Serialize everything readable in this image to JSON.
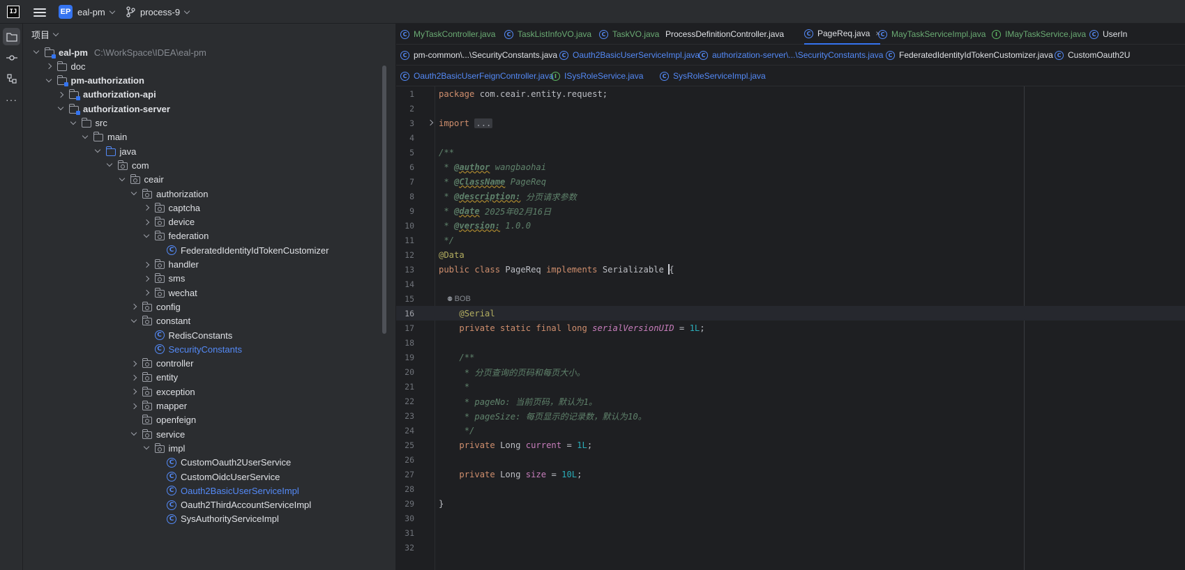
{
  "titlebar": {
    "logo_text": "IJ",
    "project_badge": "EP",
    "project_name": "eal-pm",
    "branch": "process-9"
  },
  "project_panel": {
    "title": "项目",
    "tree": [
      {
        "label": "eal-pm",
        "path": "C:\\WorkSpace\\IDEA\\eal-pm",
        "depth": 0,
        "arrow": "down",
        "icon": "module-folder",
        "bold": true
      },
      {
        "label": "doc",
        "depth": 1,
        "arrow": "right",
        "icon": "folder"
      },
      {
        "label": "pm-authorization",
        "depth": 1,
        "arrow": "down",
        "icon": "module-folder",
        "bold": true
      },
      {
        "label": "authorization-api",
        "depth": 2,
        "arrow": "right",
        "icon": "module-folder",
        "bold": true
      },
      {
        "label": "authorization-server",
        "depth": 2,
        "arrow": "down",
        "icon": "module-folder",
        "bold": true
      },
      {
        "label": "src",
        "depth": 3,
        "arrow": "down",
        "icon": "folder"
      },
      {
        "label": "main",
        "depth": 4,
        "arrow": "down",
        "icon": "folder"
      },
      {
        "label": "java",
        "depth": 5,
        "arrow": "down",
        "icon": "source-folder"
      },
      {
        "label": "com",
        "depth": 6,
        "arrow": "down",
        "icon": "package"
      },
      {
        "label": "ceair",
        "depth": 7,
        "arrow": "down",
        "icon": "package"
      },
      {
        "label": "authorization",
        "depth": 8,
        "arrow": "down",
        "icon": "package"
      },
      {
        "label": "captcha",
        "depth": 9,
        "arrow": "right",
        "icon": "package"
      },
      {
        "label": "device",
        "depth": 9,
        "arrow": "right",
        "icon": "package"
      },
      {
        "label": "federation",
        "depth": 9,
        "arrow": "down",
        "icon": "package"
      },
      {
        "label": "FederatedIdentityIdTokenCustomizer",
        "depth": 10,
        "arrow": "none",
        "icon": "class"
      },
      {
        "label": "handler",
        "depth": 9,
        "arrow": "right",
        "icon": "package"
      },
      {
        "label": "sms",
        "depth": 9,
        "arrow": "right",
        "icon": "package"
      },
      {
        "label": "wechat",
        "depth": 9,
        "arrow": "right",
        "icon": "package"
      },
      {
        "label": "config",
        "depth": 8,
        "arrow": "right",
        "icon": "package"
      },
      {
        "label": "constant",
        "depth": 8,
        "arrow": "down",
        "icon": "package"
      },
      {
        "label": "RedisConstants",
        "depth": 9,
        "arrow": "none",
        "icon": "class"
      },
      {
        "label": "SecurityConstants",
        "depth": 9,
        "arrow": "none",
        "icon": "class",
        "highlight": true
      },
      {
        "label": "controller",
        "depth": 8,
        "arrow": "right",
        "icon": "package"
      },
      {
        "label": "entity",
        "depth": 8,
        "arrow": "right",
        "icon": "package"
      },
      {
        "label": "exception",
        "depth": 8,
        "arrow": "right",
        "icon": "package"
      },
      {
        "label": "mapper",
        "depth": 8,
        "arrow": "right",
        "icon": "package"
      },
      {
        "label": "openfeign",
        "depth": 8,
        "arrow": "none",
        "icon": "package"
      },
      {
        "label": "service",
        "depth": 8,
        "arrow": "down",
        "icon": "package"
      },
      {
        "label": "impl",
        "depth": 9,
        "arrow": "down",
        "icon": "package"
      },
      {
        "label": "CustomOauth2UserService",
        "depth": 10,
        "arrow": "none",
        "icon": "class"
      },
      {
        "label": "CustomOidcUserService",
        "depth": 10,
        "arrow": "none",
        "icon": "class"
      },
      {
        "label": "Oauth2BasicUserServiceImpl",
        "depth": 10,
        "arrow": "none",
        "icon": "class",
        "highlight": true
      },
      {
        "label": "Oauth2ThirdAccountServiceImpl",
        "depth": 10,
        "arrow": "none",
        "icon": "class"
      },
      {
        "label": "SysAuthorityServiceImpl",
        "depth": 10,
        "arrow": "none",
        "icon": "class"
      }
    ]
  },
  "tabs": {
    "row1": [
      {
        "label": "MyTaskController.java",
        "icon": "class",
        "color": "green"
      },
      {
        "label": "TaskListInfoVO.java",
        "icon": "class",
        "color": "green"
      },
      {
        "label": "TaskVO.java",
        "icon": "class",
        "color": "green"
      },
      {
        "label": "ProcessDefinitionController.java",
        "icon": "none",
        "color": "normal"
      },
      {
        "label": "PageReq.java",
        "icon": "class",
        "color": "normal",
        "active": true,
        "close": "×"
      },
      {
        "label": "MayTaskServiceImpl.java",
        "icon": "class",
        "color": "green"
      },
      {
        "label": "IMayTaskService.java",
        "icon": "interface",
        "color": "green"
      },
      {
        "label": "UserIn",
        "icon": "class",
        "color": "normal"
      }
    ],
    "row2": [
      {
        "label": "pm-common\\...\\SecurityConstants.java",
        "icon": "class",
        "color": "normal"
      },
      {
        "label": "Oauth2BasicUserServiceImpl.java",
        "icon": "class",
        "color": "blue"
      },
      {
        "label": "authorization-server\\...\\SecurityConstants.java",
        "icon": "class",
        "color": "blue"
      },
      {
        "label": "FederatedIdentityIdTokenCustomizer.java",
        "icon": "class",
        "color": "normal"
      },
      {
        "label": "CustomOauth2U",
        "icon": "class",
        "color": "normal"
      }
    ],
    "row3": [
      {
        "label": "Oauth2BasicUserFeignController.java",
        "icon": "class",
        "color": "blue"
      },
      {
        "label": "ISysRoleService.java",
        "icon": "interface",
        "color": "blue"
      },
      {
        "label": "SysRoleServiceImpl.java",
        "icon": "class",
        "color": "blue"
      }
    ]
  },
  "code": {
    "current_line": 16,
    "inlay_author": "BOB",
    "lines": [
      [
        [
          "kw",
          "package "
        ],
        [
          "tx",
          "com.ceair.entity.request;"
        ]
      ],
      [],
      [
        [
          "kw",
          "import "
        ],
        [
          "fold",
          "..."
        ]
      ],
      [],
      [
        [
          "dc",
          "/**"
        ]
      ],
      [
        [
          "dc",
          " * "
        ],
        [
          "dtag",
          "@author"
        ],
        [
          "dc",
          " wangbaohai"
        ]
      ],
      [
        [
          "dc",
          " * "
        ],
        [
          "dtag",
          "@ClassName"
        ],
        [
          "dc",
          " PageReq"
        ]
      ],
      [
        [
          "dc",
          " * "
        ],
        [
          "dtag",
          "@description:"
        ],
        [
          "dc",
          " 分页请求参数"
        ]
      ],
      [
        [
          "dc",
          " * "
        ],
        [
          "dtag",
          "@date"
        ],
        [
          "dc",
          " 2025年02月16日"
        ]
      ],
      [
        [
          "dc",
          " * "
        ],
        [
          "dtag",
          "@version:"
        ],
        [
          "dc",
          " 1.0.0"
        ]
      ],
      [
        [
          "dc",
          " */"
        ]
      ],
      [
        [
          "ann",
          "@Data"
        ]
      ],
      [
        [
          "kw",
          "public class "
        ],
        [
          "tx",
          "PageReq "
        ],
        [
          "kw",
          "implements "
        ],
        [
          "tx",
          "Serializable "
        ],
        [
          "caret",
          ""
        ],
        [
          "tx",
          "{"
        ]
      ],
      [],
      [],
      [
        [
          "tx",
          "    "
        ],
        [
          "ann",
          "@Serial"
        ]
      ],
      [
        [
          "tx",
          "    "
        ],
        [
          "kw",
          "private static final long "
        ],
        [
          "sfld",
          "serialVersionUID"
        ],
        [
          "tx",
          " = "
        ],
        [
          "num",
          "1L"
        ],
        [
          "tx",
          ";"
        ]
      ],
      [],
      [
        [
          "tx",
          "    "
        ],
        [
          "dc",
          "/**"
        ]
      ],
      [
        [
          "tx",
          "    "
        ],
        [
          "dc",
          " * 分页查询的页码和每页大小。"
        ]
      ],
      [
        [
          "tx",
          "    "
        ],
        [
          "dc",
          " * "
        ]
      ],
      [
        [
          "tx",
          "    "
        ],
        [
          "dc",
          " * pageNo: 当前页码，默认为1。"
        ]
      ],
      [
        [
          "tx",
          "    "
        ],
        [
          "dc",
          " * pageSize: 每页显示的记录数，默认为10。"
        ]
      ],
      [
        [
          "tx",
          "    "
        ],
        [
          "dc",
          " */"
        ]
      ],
      [
        [
          "tx",
          "    "
        ],
        [
          "kw",
          "private "
        ],
        [
          "tx",
          "Long "
        ],
        [
          "fld",
          "current"
        ],
        [
          "tx",
          " = "
        ],
        [
          "num",
          "1L"
        ],
        [
          "tx",
          ";"
        ]
      ],
      [],
      [
        [
          "tx",
          "    "
        ],
        [
          "kw",
          "private "
        ],
        [
          "tx",
          "Long "
        ],
        [
          "fld",
          "size"
        ],
        [
          "tx",
          " = "
        ],
        [
          "num",
          "10L"
        ],
        [
          "tx",
          ";"
        ]
      ],
      [],
      [
        [
          "tx",
          "}"
        ]
      ],
      [],
      [],
      []
    ]
  }
}
